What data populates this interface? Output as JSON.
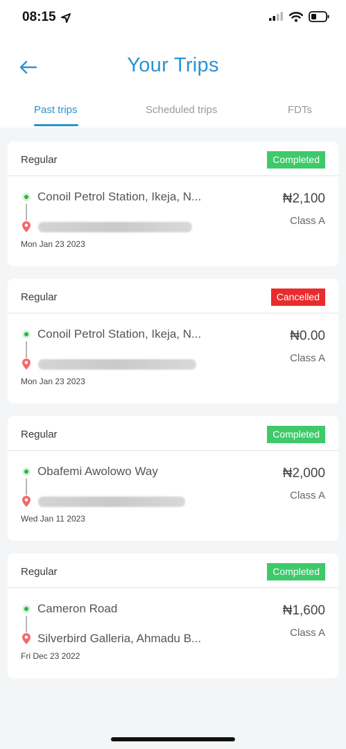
{
  "status_bar": {
    "time": "08:15"
  },
  "header": {
    "title": "Your Trips",
    "tabs": [
      {
        "label": "Past trips"
      },
      {
        "label": "Scheduled trips"
      },
      {
        "label": "FDTs"
      }
    ]
  },
  "trips": [
    {
      "type": "Regular",
      "status": "Completed",
      "origin": "Conoil Petrol Station, Ikeja, N...",
      "destination": "",
      "date": "Mon Jan 23 2023",
      "fare": "₦2,100",
      "class": "Class A"
    },
    {
      "type": "Regular",
      "status": "Cancelled",
      "origin": "Conoil Petrol Station, Ikeja, N...",
      "destination": "",
      "date": "Mon Jan 23 2023",
      "fare": "₦0.00",
      "class": "Class A"
    },
    {
      "type": "Regular",
      "status": "Completed",
      "origin": "Obafemi Awolowo Way",
      "destination": "",
      "date": "Wed Jan 11 2023",
      "fare": "₦2,000",
      "class": "Class A"
    },
    {
      "type": "Regular",
      "status": "Completed",
      "origin": "Cameron Road",
      "destination": "Silverbird Galleria, Ahmadu B...",
      "date": "Fri Dec 23 2022",
      "fare": "₦1,600",
      "class": "Class A"
    }
  ],
  "colors": {
    "accent": "#2b93cf",
    "completed": "#3ec96a",
    "cancelled": "#ea2b2b"
  }
}
